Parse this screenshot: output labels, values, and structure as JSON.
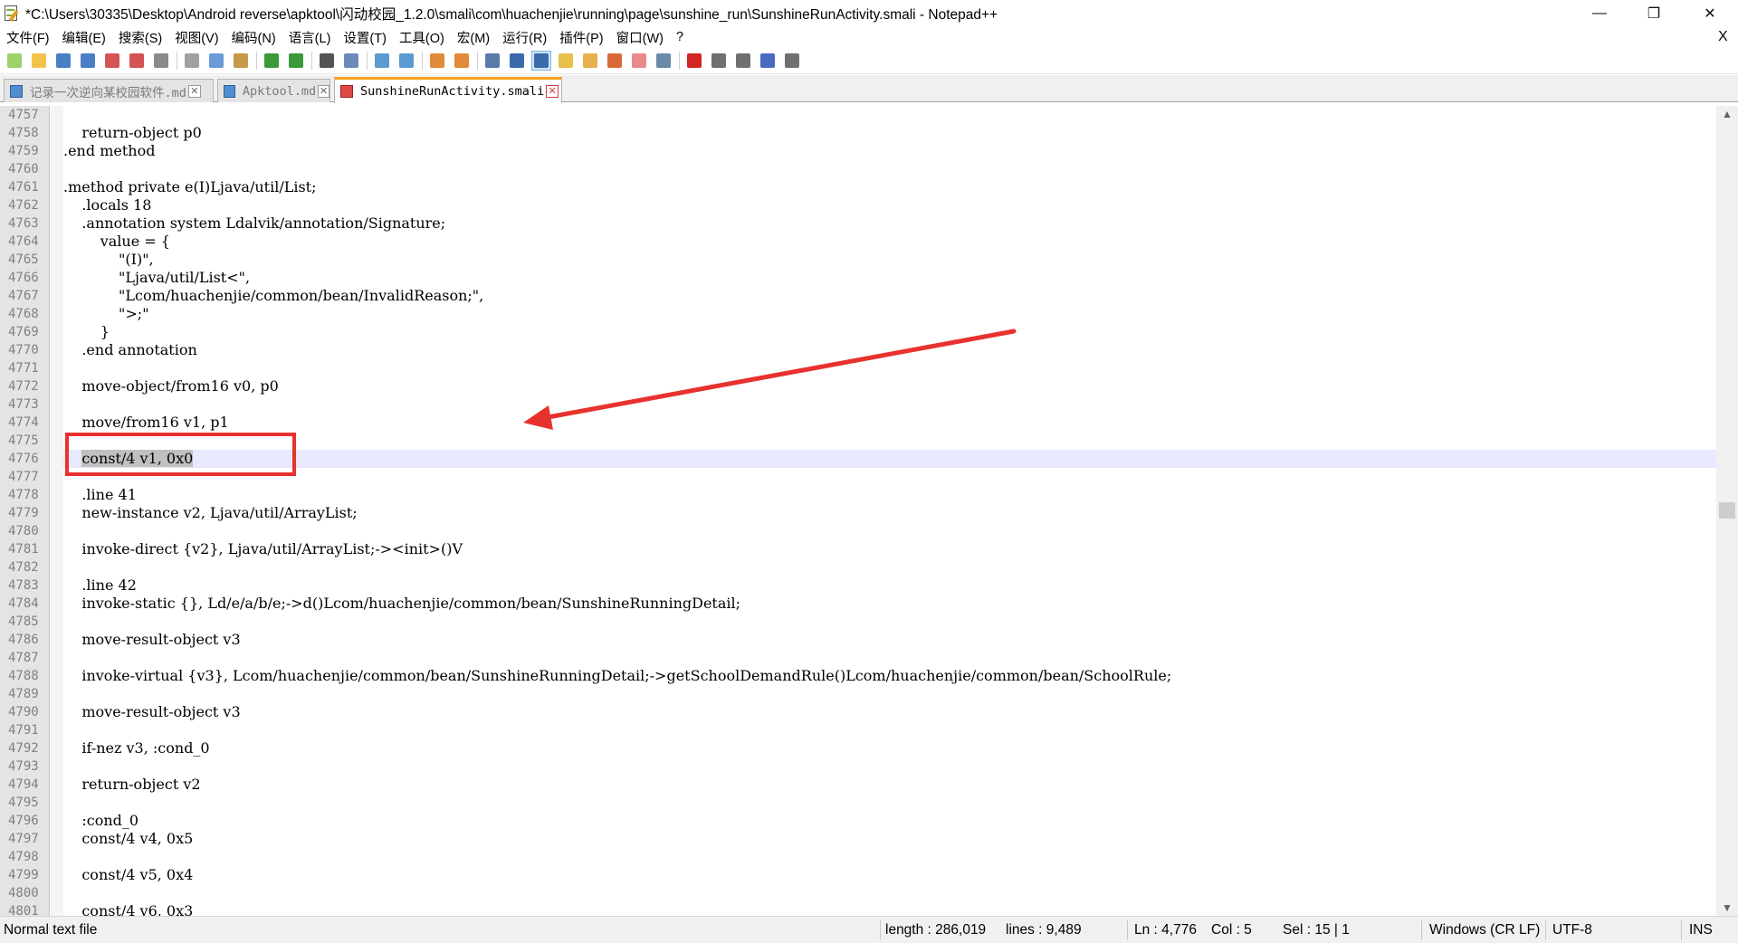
{
  "window": {
    "title": "*C:\\Users\\30335\\Desktop\\Android reverse\\apktool\\闪动校园_1.2.0\\smali\\com\\huachenjie\\running\\page\\sunshine_run\\SunshineRunActivity.smali - Notepad++",
    "min_glyph": "—",
    "max_glyph": "❐",
    "close_glyph": "✕"
  },
  "menu": {
    "items": [
      "文件(F)",
      "编辑(E)",
      "搜索(S)",
      "视图(V)",
      "编码(N)",
      "语言(L)",
      "设置(T)",
      "工具(O)",
      "宏(M)",
      "运行(R)",
      "插件(P)",
      "窗口(W)",
      "?"
    ],
    "close_glyph": "X"
  },
  "toolbar": {
    "buttons": [
      {
        "icon": "new-file-icon",
        "color": "#9bd26a"
      },
      {
        "icon": "open-file-icon",
        "color": "#f2c24a"
      },
      {
        "icon": "save-icon",
        "color": "#4a7fc4"
      },
      {
        "icon": "save-all-icon",
        "color": "#4a7fc4"
      },
      {
        "icon": "close-file-icon",
        "color": "#d45454"
      },
      {
        "icon": "close-all-icon",
        "color": "#d45454"
      },
      {
        "icon": "print-icon",
        "color": "#8a8a8a"
      },
      {
        "sep": true
      },
      {
        "icon": "cut-icon",
        "color": "#a0a0a0"
      },
      {
        "icon": "copy-icon",
        "color": "#6a9bd8"
      },
      {
        "icon": "paste-icon",
        "color": "#c69a4a"
      },
      {
        "sep": true
      },
      {
        "icon": "undo-icon",
        "color": "#3a9a3a"
      },
      {
        "icon": "redo-icon",
        "color": "#3a9a3a"
      },
      {
        "sep": true
      },
      {
        "icon": "find-icon",
        "color": "#555555"
      },
      {
        "icon": "replace-icon",
        "color": "#6a8aba"
      },
      {
        "sep": true
      },
      {
        "icon": "zoom-in-icon",
        "color": "#5a9ad0"
      },
      {
        "icon": "zoom-out-icon",
        "color": "#5a9ad0"
      },
      {
        "sep": true
      },
      {
        "icon": "sync-vertical-icon",
        "color": "#e08a3a"
      },
      {
        "icon": "sync-horizontal-icon",
        "color": "#e08a3a"
      },
      {
        "sep": true
      },
      {
        "icon": "word-wrap-icon",
        "color": "#5a7aaa"
      },
      {
        "icon": "show-all-chars-icon",
        "color": "#3a6aaa"
      },
      {
        "icon": "indent-guide-icon",
        "color": "#3a6aaa",
        "active": true
      },
      {
        "icon": "user-lang-icon",
        "color": "#e8c04a"
      },
      {
        "icon": "doc-map-icon",
        "color": "#e8b04a"
      },
      {
        "icon": "function-list-icon",
        "color": "#d86a3a"
      },
      {
        "icon": "folder-workspace-icon",
        "color": "#e88a8a"
      },
      {
        "icon": "monitoring-icon",
        "color": "#6a8aaa"
      },
      {
        "sep": true
      },
      {
        "icon": "record-macro-icon",
        "color": "#d42424"
      },
      {
        "icon": "stop-macro-icon",
        "color": "#707070"
      },
      {
        "icon": "play-macro-icon",
        "color": "#707070"
      },
      {
        "icon": "run-macro-multiple-icon",
        "color": "#4a6ac0"
      },
      {
        "icon": "save-macro-icon",
        "color": "#707070"
      }
    ]
  },
  "tabs": [
    {
      "label": "记录一次逆向某校园软件.md",
      "active": false,
      "dirty": false
    },
    {
      "label": "Apktool.md",
      "active": false,
      "dirty": false
    },
    {
      "label": "SunshineRunActivity.smali",
      "active": true,
      "dirty": true
    }
  ],
  "tab_close_glyph": "✕",
  "editor": {
    "current_line": 4776,
    "lines": [
      {
        "n": "4757",
        "t": ""
      },
      {
        "n": "4758",
        "t": "    return-object p0"
      },
      {
        "n": "4759",
        "t": ".end method"
      },
      {
        "n": "4760",
        "t": ""
      },
      {
        "n": "4761",
        "t": ".method private e(I)Ljava/util/List;"
      },
      {
        "n": "4762",
        "t": "    .locals 18"
      },
      {
        "n": "4763",
        "t": "    .annotation system Ldalvik/annotation/Signature;"
      },
      {
        "n": "4764",
        "t": "        value = {"
      },
      {
        "n": "4765",
        "t": "            \"(I)\","
      },
      {
        "n": "4766",
        "t": "            \"Ljava/util/List<\","
      },
      {
        "n": "4767",
        "t": "            \"Lcom/huachenjie/common/bean/InvalidReason;\","
      },
      {
        "n": "4768",
        "t": "            \">;\""
      },
      {
        "n": "4769",
        "t": "        }"
      },
      {
        "n": "4770",
        "t": "    .end annotation"
      },
      {
        "n": "4771",
        "t": ""
      },
      {
        "n": "4772",
        "t": "    move-object/from16 v0, p0"
      },
      {
        "n": "4773",
        "t": ""
      },
      {
        "n": "4774",
        "t": "    move/from16 v1, p1"
      },
      {
        "n": "4775",
        "t": ""
      },
      {
        "n": "4776",
        "t": "    const/4 v1, 0x0",
        "selected": "const/4 v1, 0x0"
      },
      {
        "n": "4777",
        "t": ""
      },
      {
        "n": "4778",
        "t": "    .line 41"
      },
      {
        "n": "4779",
        "t": "    new-instance v2, Ljava/util/ArrayList;"
      },
      {
        "n": "4780",
        "t": ""
      },
      {
        "n": "4781",
        "t": "    invoke-direct {v2}, Ljava/util/ArrayList;-><init>()V"
      },
      {
        "n": "4782",
        "t": ""
      },
      {
        "n": "4783",
        "t": "    .line 42"
      },
      {
        "n": "4784",
        "t": "    invoke-static {}, Ld/e/a/b/e;->d()Lcom/huachenjie/common/bean/SunshineRunningDetail;"
      },
      {
        "n": "4785",
        "t": ""
      },
      {
        "n": "4786",
        "t": "    move-result-object v3"
      },
      {
        "n": "4787",
        "t": ""
      },
      {
        "n": "4788",
        "t": "    invoke-virtual {v3}, Lcom/huachenjie/common/bean/SunshineRunningDetail;->getSchoolDemandRule()Lcom/huachenjie/common/bean/SchoolRule;"
      },
      {
        "n": "4789",
        "t": ""
      },
      {
        "n": "4790",
        "t": "    move-result-object v3"
      },
      {
        "n": "4791",
        "t": ""
      },
      {
        "n": "4792",
        "t": "    if-nez v3, :cond_0"
      },
      {
        "n": "4793",
        "t": ""
      },
      {
        "n": "4794",
        "t": "    return-object v2"
      },
      {
        "n": "4795",
        "t": ""
      },
      {
        "n": "4796",
        "t": "    :cond_0"
      },
      {
        "n": "4797",
        "t": "    const/4 v4, 0x5"
      },
      {
        "n": "4798",
        "t": ""
      },
      {
        "n": "4799",
        "t": "    const/4 v5, 0x4"
      },
      {
        "n": "4800",
        "t": ""
      },
      {
        "n": "4801",
        "t": "    const/4 v6, 0x3"
      }
    ]
  },
  "scrollbar": {
    "up_glyph": "▲",
    "down_glyph": "▼"
  },
  "status": {
    "file_type": "Normal text file",
    "length": "length : 286,019",
    "lines": "lines : 9,489",
    "ln": "Ln : 4,776",
    "col": "Col : 5",
    "sel": "Sel : 15 | 1",
    "eol": "Windows (CR LF)",
    "encoding": "UTF-8",
    "mode": "INS"
  },
  "colors": {
    "annotation_red": "#e8322e",
    "current_line_bg": "#e8e8ff",
    "tab_accent": "#f9a11b"
  }
}
